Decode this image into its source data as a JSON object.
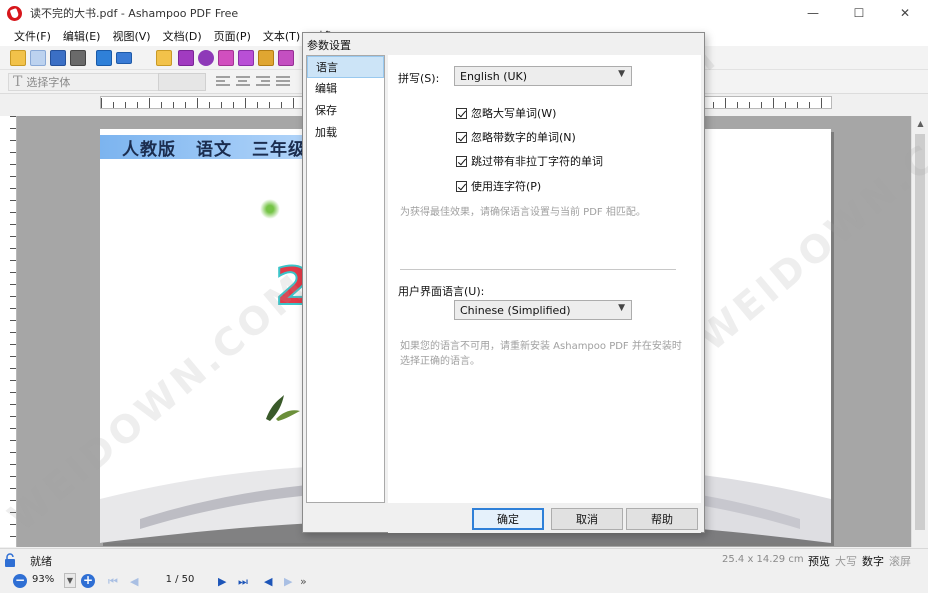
{
  "window": {
    "title": "读不完的大书.pdf - Ashampoo PDF Free",
    "minimize_glyph": "—",
    "maximize_glyph": "☐",
    "close_glyph": "✕"
  },
  "menu": {
    "items": [
      "文件(F)",
      "编辑(E)",
      "视图(V)",
      "文档(D)",
      "页面(P)",
      "文本(T)",
      "对象"
    ]
  },
  "format_toolbar": {
    "font_glyph": "T",
    "font_placeholder": "选择字体"
  },
  "document": {
    "banner": [
      "人教版",
      "语文",
      "三年级"
    ],
    "big_digit": "2"
  },
  "watermark": "WEIDOWN.COM",
  "status": {
    "text": "就绪",
    "dimensions": "25.4 x 14.29 cm",
    "keys": [
      {
        "label": "预览",
        "active": true
      },
      {
        "label": "大写",
        "active": false
      },
      {
        "label": "数字",
        "active": true
      },
      {
        "label": "滚屏",
        "active": false
      }
    ]
  },
  "navigation": {
    "zoom_out": "−",
    "zoom_in": "+",
    "zoom": "93%",
    "page": "1 / 50",
    "first": "⏮",
    "prev": "◀",
    "next": "▶",
    "last": "⏭",
    "back": "◀",
    "forward": "▶",
    "more": "»"
  },
  "dialog": {
    "title": "参数设置",
    "nav": [
      "语言",
      "编辑",
      "保存",
      "加载"
    ],
    "selected_nav": "语言",
    "spelling_label": "拼写(S):",
    "spelling_value": "English (UK)",
    "checkboxes": [
      {
        "label": "忽略大写单词(W)",
        "checked": true
      },
      {
        "label": "忽略带数字的单词(N)",
        "checked": true
      },
      {
        "label": "跳过带有非拉丁字符的单词",
        "checked": true
      },
      {
        "label": "使用连字符(P)",
        "checked": true
      }
    ],
    "spelling_hint": "为获得最佳效果，请确保语言设置与当前 PDF 相匹配。",
    "ui_language_label": "用户界面语言(U):",
    "ui_language_value": "Chinese (Simplified)",
    "ui_language_hint": "如果您的语言不可用，请重新安装 Ashampoo PDF 并在安装时选择正确的语言。",
    "buttons": {
      "ok": "确定",
      "cancel": "取消",
      "help": "帮助"
    },
    "chevron": "▼"
  },
  "colors": {
    "accent": "#2f80d8",
    "selection": "#cce4f7",
    "workspace": "#a6a6a6",
    "nav_blue": "#1d55b8"
  }
}
